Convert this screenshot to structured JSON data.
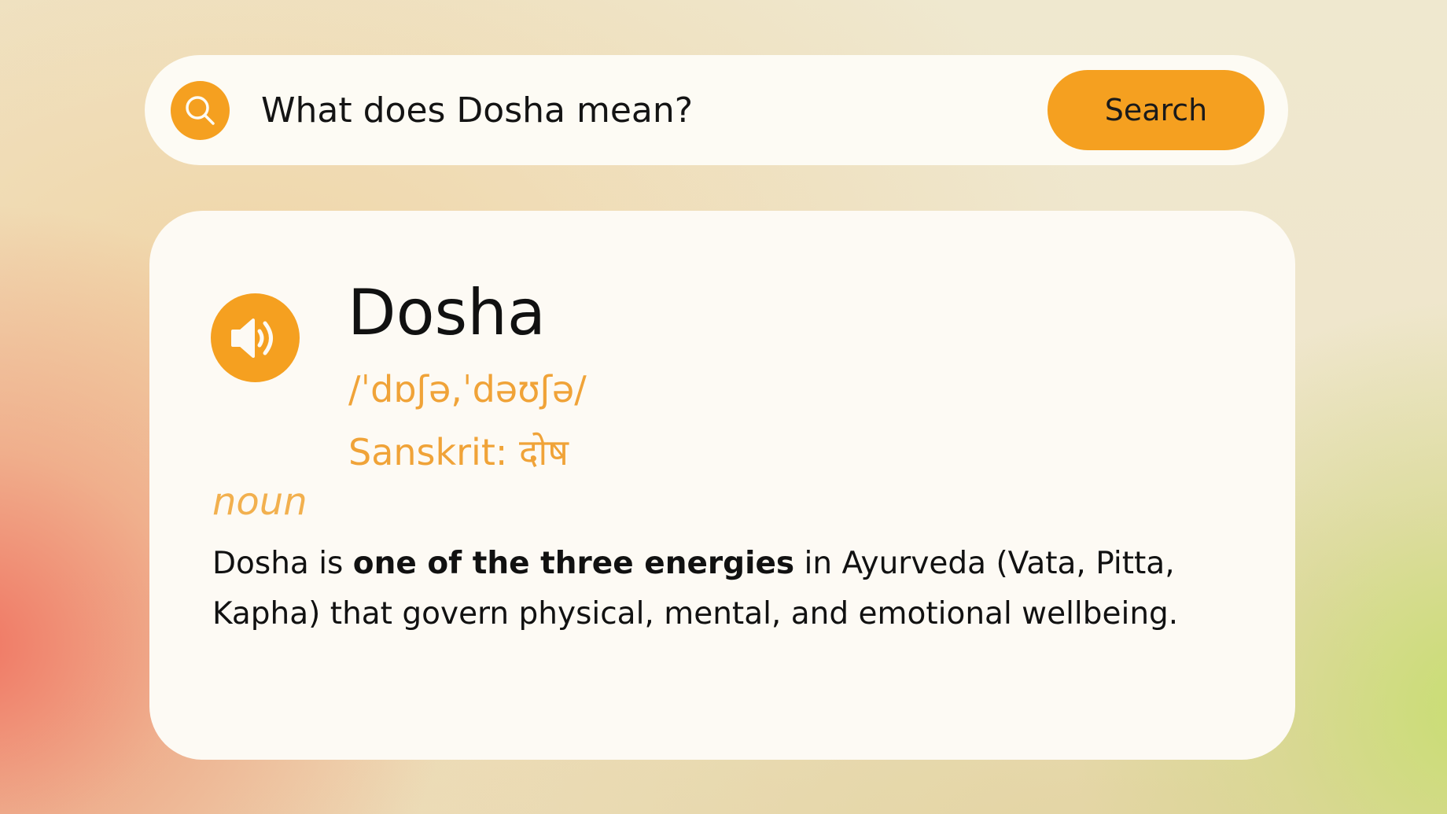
{
  "search": {
    "query": "What does Dosha mean?",
    "button_label": "Search"
  },
  "entry": {
    "word": "Dosha",
    "pronunciation": "/ˈdɒʃə,ˈdəʊʃə/",
    "origin": "Sanskrit: दोष",
    "part_of_speech": "noun",
    "definition": {
      "before": "Dosha is ",
      "emphasis": "one of the three energies",
      "after": " in Ayurveda (Vata, Pitta, Kapha) that govern physical, mental, and emotional wellbeing."
    }
  },
  "icons": {
    "search": "search-icon",
    "audio": "speaker-icon"
  },
  "colors": {
    "accent": "#f5a020",
    "accent_text": "#f0a338",
    "card_background": "#fdfaf4",
    "text": "#111111"
  }
}
